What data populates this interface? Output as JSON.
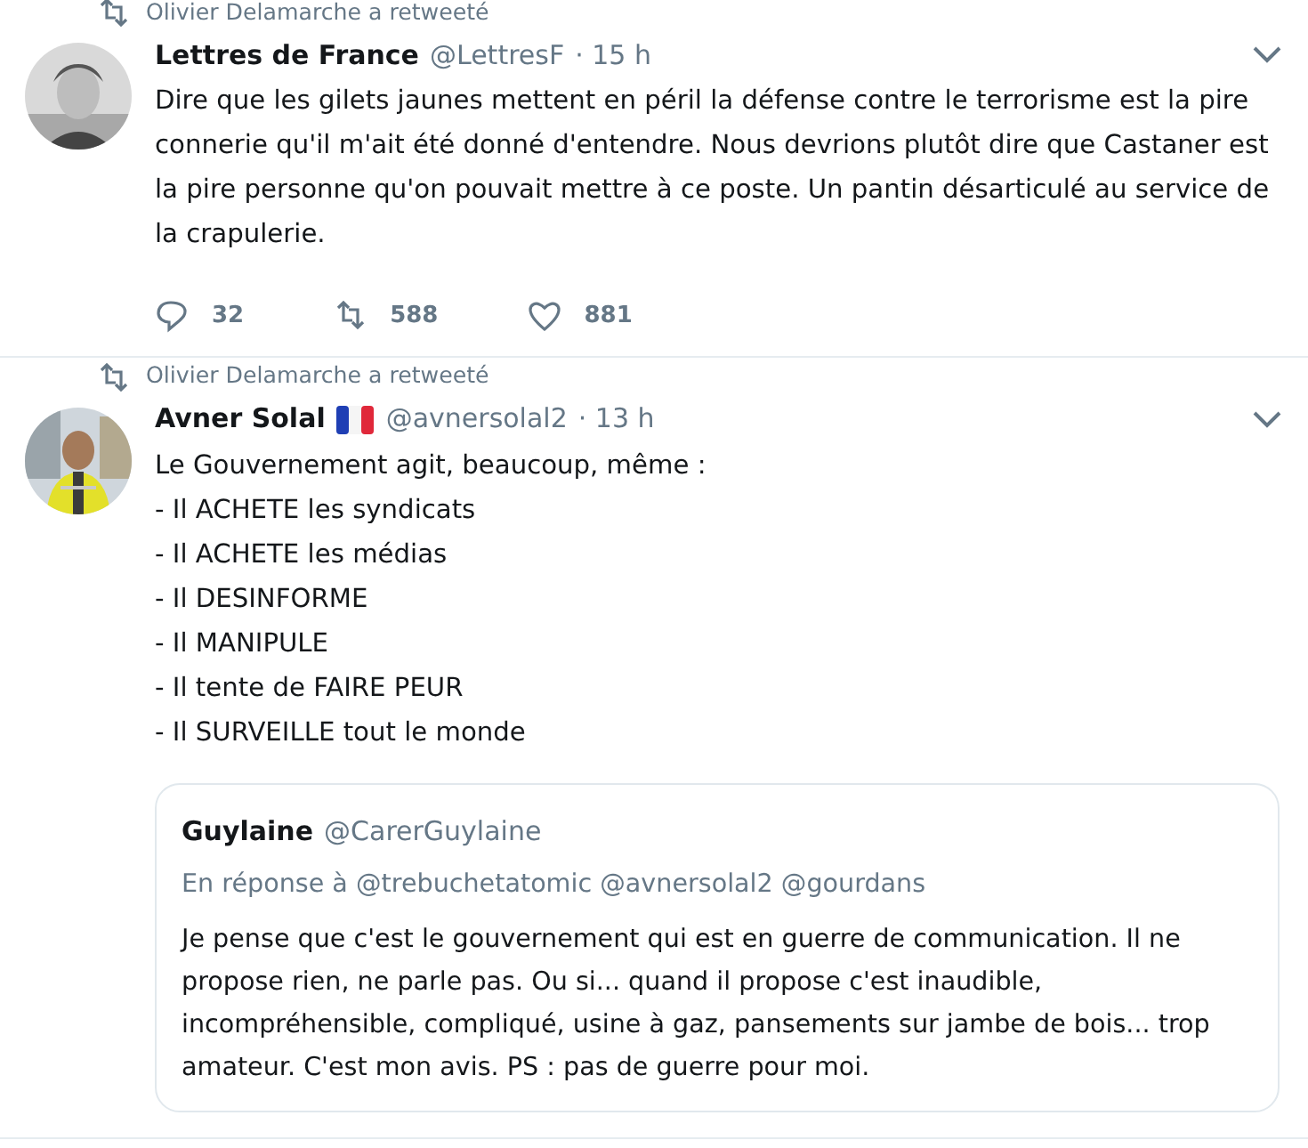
{
  "tweets": [
    {
      "retweeted_by": "Olivier Delamarche a retweeté",
      "name": "Lettres de France",
      "handle": "@LettresF",
      "time": "· 15 h",
      "flag": false,
      "lines": [
        "Dire que les gilets jaunes mettent en péril la défense contre le terrorisme est la pire connerie qu'il m'ait été donné d'entendre. Nous devrions plutôt dire que Castaner est la pire personne qu'on pouvait mettre à ce poste. Un pantin désarticulé au service de la crapulerie."
      ],
      "actions": {
        "replies": "32",
        "retweets": "588",
        "likes": "881"
      }
    },
    {
      "retweeted_by": "Olivier Delamarche a retweeté",
      "name": "Avner Solal",
      "handle": "@avnersolal2",
      "time": "· 13 h",
      "flag": true,
      "lines": [
        "Le Gouvernement agit, beaucoup, même :",
        "- Il ACHETE les syndicats",
        "- Il ACHETE les médias",
        "- Il DESINFORME",
        "- Il MANIPULE",
        "- Il tente de FAIRE PEUR",
        "- Il SURVEILLE tout le monde"
      ],
      "quote": {
        "name": "Guylaine",
        "handle": "@CarerGuylaine",
        "reply_to": "En réponse à @trebuchetatomic @avnersolal2 @gourdans",
        "text": "Je pense que c'est le gouvernement qui est en guerre de communication. Il ne propose rien, ne parle pas. Ou si... quand il propose c'est inaudible, incompréhensible, compliqué, usine à gaz, pansements sur jambe de bois... trop amateur. C'est mon avis. PS : pas de guerre pour moi."
      }
    }
  ]
}
